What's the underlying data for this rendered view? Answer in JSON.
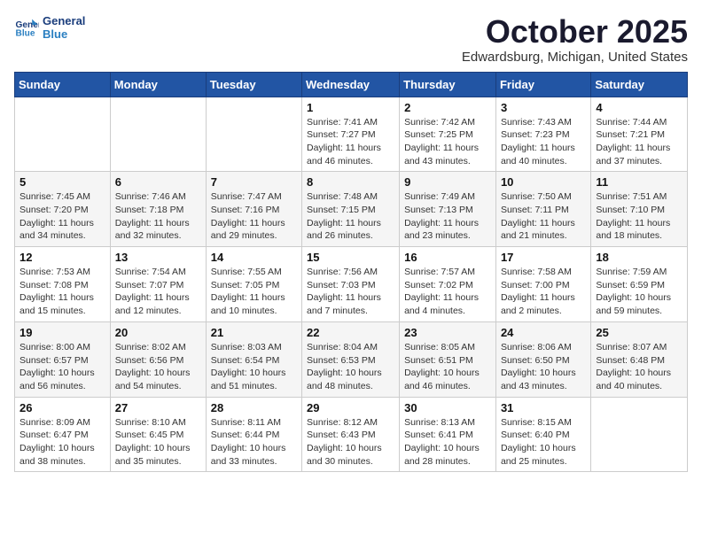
{
  "header": {
    "logo_line1": "General",
    "logo_line2": "Blue",
    "title": "October 2025",
    "subtitle": "Edwardsburg, Michigan, United States"
  },
  "weekdays": [
    "Sunday",
    "Monday",
    "Tuesday",
    "Wednesday",
    "Thursday",
    "Friday",
    "Saturday"
  ],
  "weeks": [
    [
      {
        "day": "",
        "info": ""
      },
      {
        "day": "",
        "info": ""
      },
      {
        "day": "",
        "info": ""
      },
      {
        "day": "1",
        "info": "Sunrise: 7:41 AM\nSunset: 7:27 PM\nDaylight: 11 hours and 46 minutes."
      },
      {
        "day": "2",
        "info": "Sunrise: 7:42 AM\nSunset: 7:25 PM\nDaylight: 11 hours and 43 minutes."
      },
      {
        "day": "3",
        "info": "Sunrise: 7:43 AM\nSunset: 7:23 PM\nDaylight: 11 hours and 40 minutes."
      },
      {
        "day": "4",
        "info": "Sunrise: 7:44 AM\nSunset: 7:21 PM\nDaylight: 11 hours and 37 minutes."
      }
    ],
    [
      {
        "day": "5",
        "info": "Sunrise: 7:45 AM\nSunset: 7:20 PM\nDaylight: 11 hours and 34 minutes."
      },
      {
        "day": "6",
        "info": "Sunrise: 7:46 AM\nSunset: 7:18 PM\nDaylight: 11 hours and 32 minutes."
      },
      {
        "day": "7",
        "info": "Sunrise: 7:47 AM\nSunset: 7:16 PM\nDaylight: 11 hours and 29 minutes."
      },
      {
        "day": "8",
        "info": "Sunrise: 7:48 AM\nSunset: 7:15 PM\nDaylight: 11 hours and 26 minutes."
      },
      {
        "day": "9",
        "info": "Sunrise: 7:49 AM\nSunset: 7:13 PM\nDaylight: 11 hours and 23 minutes."
      },
      {
        "day": "10",
        "info": "Sunrise: 7:50 AM\nSunset: 7:11 PM\nDaylight: 11 hours and 21 minutes."
      },
      {
        "day": "11",
        "info": "Sunrise: 7:51 AM\nSunset: 7:10 PM\nDaylight: 11 hours and 18 minutes."
      }
    ],
    [
      {
        "day": "12",
        "info": "Sunrise: 7:53 AM\nSunset: 7:08 PM\nDaylight: 11 hours and 15 minutes."
      },
      {
        "day": "13",
        "info": "Sunrise: 7:54 AM\nSunset: 7:07 PM\nDaylight: 11 hours and 12 minutes."
      },
      {
        "day": "14",
        "info": "Sunrise: 7:55 AM\nSunset: 7:05 PM\nDaylight: 11 hours and 10 minutes."
      },
      {
        "day": "15",
        "info": "Sunrise: 7:56 AM\nSunset: 7:03 PM\nDaylight: 11 hours and 7 minutes."
      },
      {
        "day": "16",
        "info": "Sunrise: 7:57 AM\nSunset: 7:02 PM\nDaylight: 11 hours and 4 minutes."
      },
      {
        "day": "17",
        "info": "Sunrise: 7:58 AM\nSunset: 7:00 PM\nDaylight: 11 hours and 2 minutes."
      },
      {
        "day": "18",
        "info": "Sunrise: 7:59 AM\nSunset: 6:59 PM\nDaylight: 10 hours and 59 minutes."
      }
    ],
    [
      {
        "day": "19",
        "info": "Sunrise: 8:00 AM\nSunset: 6:57 PM\nDaylight: 10 hours and 56 minutes."
      },
      {
        "day": "20",
        "info": "Sunrise: 8:02 AM\nSunset: 6:56 PM\nDaylight: 10 hours and 54 minutes."
      },
      {
        "day": "21",
        "info": "Sunrise: 8:03 AM\nSunset: 6:54 PM\nDaylight: 10 hours and 51 minutes."
      },
      {
        "day": "22",
        "info": "Sunrise: 8:04 AM\nSunset: 6:53 PM\nDaylight: 10 hours and 48 minutes."
      },
      {
        "day": "23",
        "info": "Sunrise: 8:05 AM\nSunset: 6:51 PM\nDaylight: 10 hours and 46 minutes."
      },
      {
        "day": "24",
        "info": "Sunrise: 8:06 AM\nSunset: 6:50 PM\nDaylight: 10 hours and 43 minutes."
      },
      {
        "day": "25",
        "info": "Sunrise: 8:07 AM\nSunset: 6:48 PM\nDaylight: 10 hours and 40 minutes."
      }
    ],
    [
      {
        "day": "26",
        "info": "Sunrise: 8:09 AM\nSunset: 6:47 PM\nDaylight: 10 hours and 38 minutes."
      },
      {
        "day": "27",
        "info": "Sunrise: 8:10 AM\nSunset: 6:45 PM\nDaylight: 10 hours and 35 minutes."
      },
      {
        "day": "28",
        "info": "Sunrise: 8:11 AM\nSunset: 6:44 PM\nDaylight: 10 hours and 33 minutes."
      },
      {
        "day": "29",
        "info": "Sunrise: 8:12 AM\nSunset: 6:43 PM\nDaylight: 10 hours and 30 minutes."
      },
      {
        "day": "30",
        "info": "Sunrise: 8:13 AM\nSunset: 6:41 PM\nDaylight: 10 hours and 28 minutes."
      },
      {
        "day": "31",
        "info": "Sunrise: 8:15 AM\nSunset: 6:40 PM\nDaylight: 10 hours and 25 minutes."
      },
      {
        "day": "",
        "info": ""
      }
    ]
  ]
}
